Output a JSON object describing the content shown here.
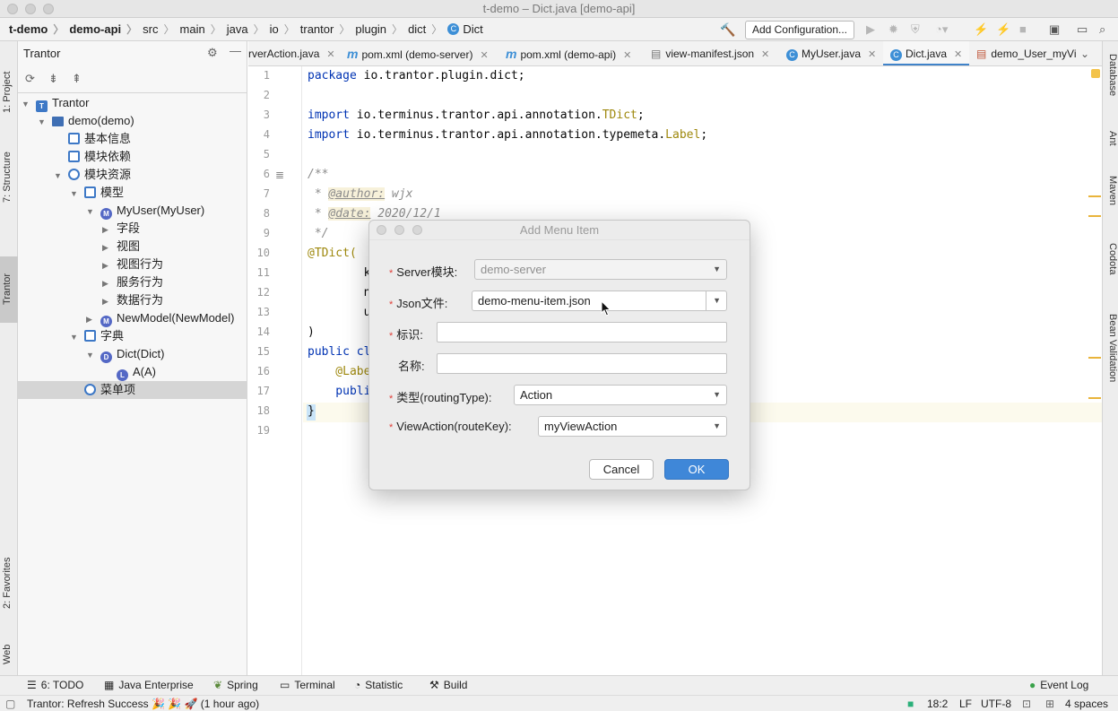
{
  "window": {
    "title": "t-demo – Dict.java [demo-api]"
  },
  "breadcrumb": [
    "t-demo",
    "demo-api",
    "src",
    "main",
    "java",
    "io",
    "trantor",
    "plugin",
    "dict",
    "Dict"
  ],
  "toolbar": {
    "add_configuration": "Add Configuration..."
  },
  "left_stripe": {
    "project": "1: Project",
    "structure": "7: Structure",
    "trantor": "Trantor",
    "favorites": "2: Favorites",
    "web": "Web"
  },
  "right_stripe": {
    "database": "Database",
    "ant": "Ant",
    "maven": "Maven",
    "codota": "Codota",
    "bean_validation": "Bean Validation"
  },
  "panel": {
    "title": "Trantor",
    "tree": [
      {
        "label": "Trantor",
        "arrow": "▼",
        "icon": "T",
        "color": "#3d78c6"
      },
      {
        "label": "demo(demo)",
        "arrow": "▼",
        "icon": "folder",
        "color": "#3f6fb4"
      },
      {
        "label": "基本信息",
        "arrow": "",
        "icon": "doc",
        "color": "#3d78c6"
      },
      {
        "label": "模块依赖",
        "arrow": "",
        "icon": "tree",
        "color": "#3d78c6"
      },
      {
        "label": "模块资源",
        "arrow": "▼",
        "icon": "globe",
        "color": "#3d78c6"
      },
      {
        "label": "模型",
        "arrow": "▼",
        "icon": "cubes",
        "color": "#3d78c6"
      },
      {
        "label": "MyUser(MyUser)",
        "arrow": "▼",
        "icon": "M",
        "color": "#5468c5"
      },
      {
        "label": "字段",
        "arrow": "▶",
        "icon": "",
        "color": ""
      },
      {
        "label": "视图",
        "arrow": "▶",
        "icon": "",
        "color": ""
      },
      {
        "label": "视图行为",
        "arrow": "▶",
        "icon": "",
        "color": ""
      },
      {
        "label": "服务行为",
        "arrow": "▶",
        "icon": "",
        "color": ""
      },
      {
        "label": "数据行为",
        "arrow": "▶",
        "icon": "",
        "color": ""
      },
      {
        "label": "NewModel(NewModel)",
        "arrow": "▶",
        "icon": "M",
        "color": "#5468c5"
      },
      {
        "label": "字典",
        "arrow": "▼",
        "icon": "book",
        "color": "#3d78c6"
      },
      {
        "label": "Dict(Dict)",
        "arrow": "▼",
        "icon": "D",
        "color": "#5468c5"
      },
      {
        "label": "A(A)",
        "arrow": "",
        "icon": "L",
        "color": "#5468c5"
      },
      {
        "label": "菜单项",
        "arrow": "",
        "icon": "list",
        "color": "#3d78c6"
      }
    ]
  },
  "tabs": [
    {
      "label": "rverAction.java",
      "icon": ""
    },
    {
      "label": "pom.xml (demo-server)",
      "icon": "m"
    },
    {
      "label": "pom.xml (demo-api)",
      "icon": "m"
    },
    {
      "label": "view-manifest.json",
      "icon": "file"
    },
    {
      "label": "MyUser.java",
      "icon": "C"
    },
    {
      "label": "Dict.java",
      "icon": "C"
    },
    {
      "label": "demo_User_myVi",
      "icon": "file"
    }
  ],
  "editor": {
    "line_numbers": [
      "1",
      "2",
      "3",
      "4",
      "5",
      "6",
      "7",
      "8",
      "9",
      "10",
      "11",
      "12",
      "13",
      "14",
      "15",
      "16",
      "17",
      "18",
      "19"
    ],
    "code": {
      "l1_kw": "package",
      "l1_rest": " io.trantor.plugin.dict;",
      "l3_kw": "import",
      "l3_rest": " io.terminus.trantor.api.annotation.",
      "l3_cls": "TDict",
      "l4_kw": "import",
      "l4_rest": " io.terminus.trantor.api.annotation.typemeta.",
      "l4_cls": "Label",
      "l6": "/**",
      "l7_pre": " * ",
      "l7_tag": "@author:",
      "l7_val": " wjx",
      "l8_pre": " * ",
      "l8_tag": "@date:",
      "l8_val": " 2020/12/1",
      "l9": " */",
      "l10": "@TDict(",
      "l11": "        k",
      "l12": "        n",
      "l13": "        u",
      "l14": ")",
      "l15_kw": "public",
      "l15_rest": " cl",
      "l16": "    @Labe",
      "l17": "    publi",
      "l18": "}"
    }
  },
  "dialog": {
    "title": "Add Menu Item",
    "fields": {
      "server_label": "Server模块:",
      "server_value": "demo-server",
      "json_label": "Json文件:",
      "json_value": "demo-menu-item.json",
      "id_label": "标识:",
      "id_value": "",
      "name_label": "名称:",
      "name_value": "",
      "type_label": "类型(routingType):",
      "type_value": "Action",
      "viewaction_label": "ViewAction(routeKey):",
      "viewaction_value": "myViewAction"
    },
    "cancel": "Cancel",
    "ok": "OK"
  },
  "bottom_tools": [
    {
      "label": "6: TODO"
    },
    {
      "label": "Java Enterprise"
    },
    {
      "label": "Spring"
    },
    {
      "label": "Terminal"
    },
    {
      "label": "Statistic"
    },
    {
      "label": "Build"
    }
  ],
  "event_log": "Event Log",
  "status": {
    "message": "Trantor: Refresh Success 🎉 🎉 🚀 (1 hour ago)",
    "position": "18:2",
    "line_sep": "LF",
    "encoding": "UTF-8",
    "indent": "4 spaces"
  },
  "colors": {
    "accent": "#3f87d8",
    "required": "#e0403a",
    "tab_underline": "#4083c9"
  }
}
